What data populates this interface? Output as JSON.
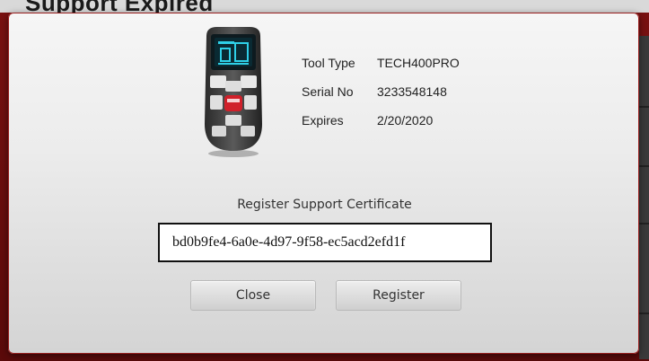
{
  "background": {
    "title_fragment": "Support Expired"
  },
  "dialog": {
    "device_image": {
      "icon": "tpms-tool-device-icon",
      "screen_color": "#2fd0e8",
      "accent_button_color": "#d0202a"
    },
    "info": [
      {
        "label": "Tool Type",
        "value": "TECH400PRO"
      },
      {
        "label": "Serial No",
        "value": "3233548148"
      },
      {
        "label": "Expires",
        "value": "2/20/2020"
      }
    ],
    "certificate": {
      "label": "Register Support Certificate",
      "value": "bd0b9fe4-6a0e-4d97-9f58-ec5acd2efd1f"
    },
    "buttons": {
      "close": "Close",
      "register": "Register"
    }
  },
  "colors": {
    "frame_red": "#7a1212",
    "dialog_bg": "#ececec"
  }
}
